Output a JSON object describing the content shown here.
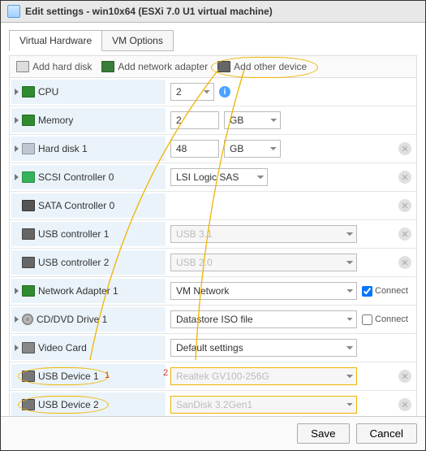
{
  "window": {
    "title": "Edit settings - win10x64 (ESXi 7.0 U1 virtual machine)"
  },
  "tabs": {
    "hardware": "Virtual Hardware",
    "options": "VM Options"
  },
  "toolbar": {
    "add_disk": "Add hard disk",
    "add_nic": "Add network adapter",
    "add_other": "Add other device"
  },
  "rows": {
    "cpu": {
      "label": "CPU",
      "value": "2"
    },
    "memory": {
      "label": "Memory",
      "value": "2",
      "unit": "GB"
    },
    "disk1": {
      "label": "Hard disk 1",
      "value": "48",
      "unit": "GB"
    },
    "scsi0": {
      "label": "SCSI Controller 0",
      "value": "LSI Logic SAS"
    },
    "sata0": {
      "label": "SATA Controller 0"
    },
    "usbctl1": {
      "label": "USB controller 1",
      "value": "USB 3.1"
    },
    "usbctl2": {
      "label": "USB controller 2",
      "value": "USB 2.0"
    },
    "nic1": {
      "label": "Network Adapter 1",
      "value": "VM Network",
      "connect": "Connect",
      "checked": true
    },
    "cd1": {
      "label": "CD/DVD Drive 1",
      "value": "Datastore ISO file",
      "connect": "Connect",
      "checked": false
    },
    "video": {
      "label": "Video Card",
      "value": "Default settings"
    },
    "usbdev1": {
      "label": "USB Device 1",
      "value": "Realtek GV100-256G"
    },
    "usbdev2": {
      "label": "USB Device 2",
      "value": "SanDisk 3.2Gen1"
    }
  },
  "callouts": {
    "c1": "1",
    "c2": "2"
  },
  "footer": {
    "save": "Save",
    "cancel": "Cancel"
  }
}
